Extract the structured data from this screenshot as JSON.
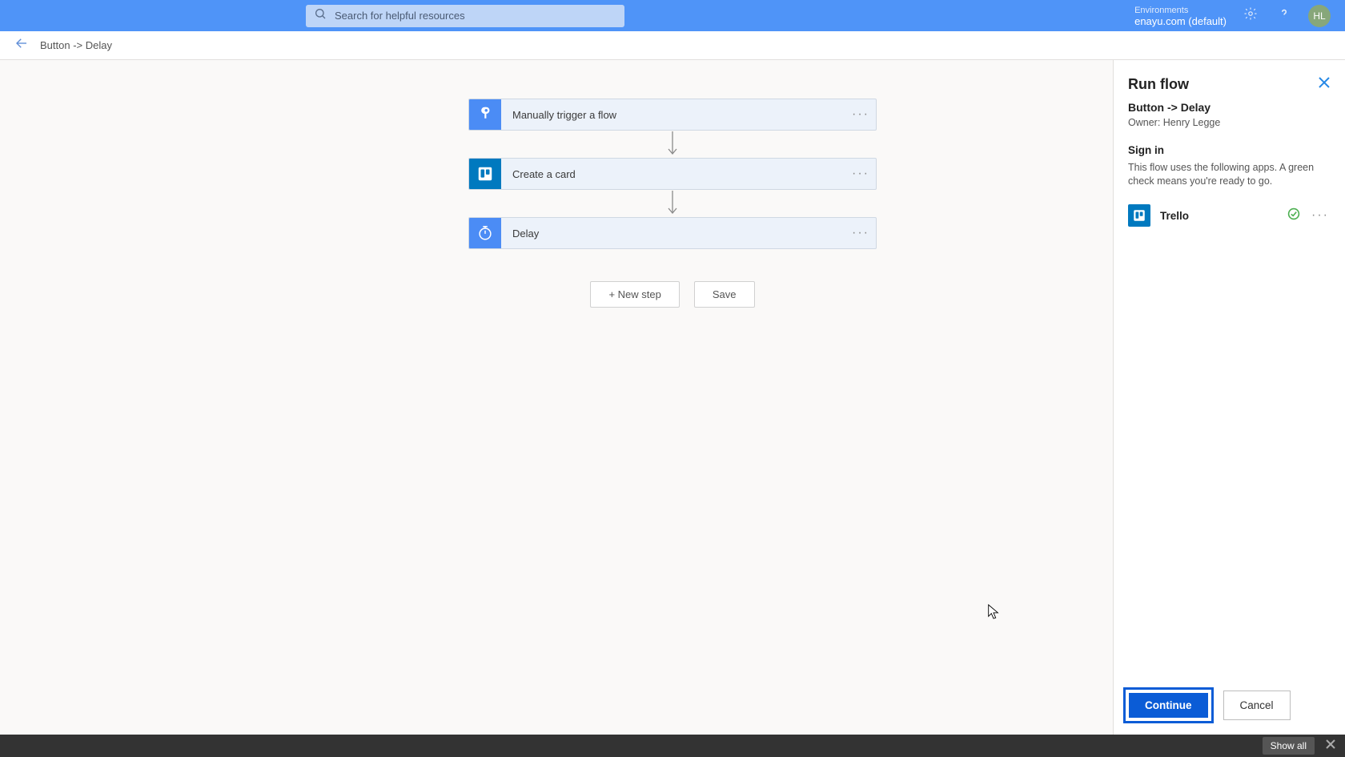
{
  "top": {
    "search_placeholder": "Search for helpful resources",
    "env_label": "Environments",
    "env_name": "enayu.com (default)",
    "avatar_initials": "HL"
  },
  "page": {
    "breadcrumb": "Button -> Delay"
  },
  "flow": {
    "steps": [
      {
        "label": "Manually trigger a flow"
      },
      {
        "label": "Create a card"
      },
      {
        "label": "Delay"
      }
    ],
    "new_step_label": "+ New step",
    "save_label": "Save"
  },
  "panel": {
    "title": "Run flow",
    "flow_name": "Button -> Delay",
    "owner_label": "Owner: Henry Legge",
    "section_title": "Sign in",
    "section_desc": "This flow uses the following apps. A green check means you're ready to go.",
    "apps": [
      {
        "name": "Trello"
      }
    ],
    "continue_label": "Continue",
    "cancel_label": "Cancel"
  },
  "bottom": {
    "show_all_label": "Show all"
  }
}
